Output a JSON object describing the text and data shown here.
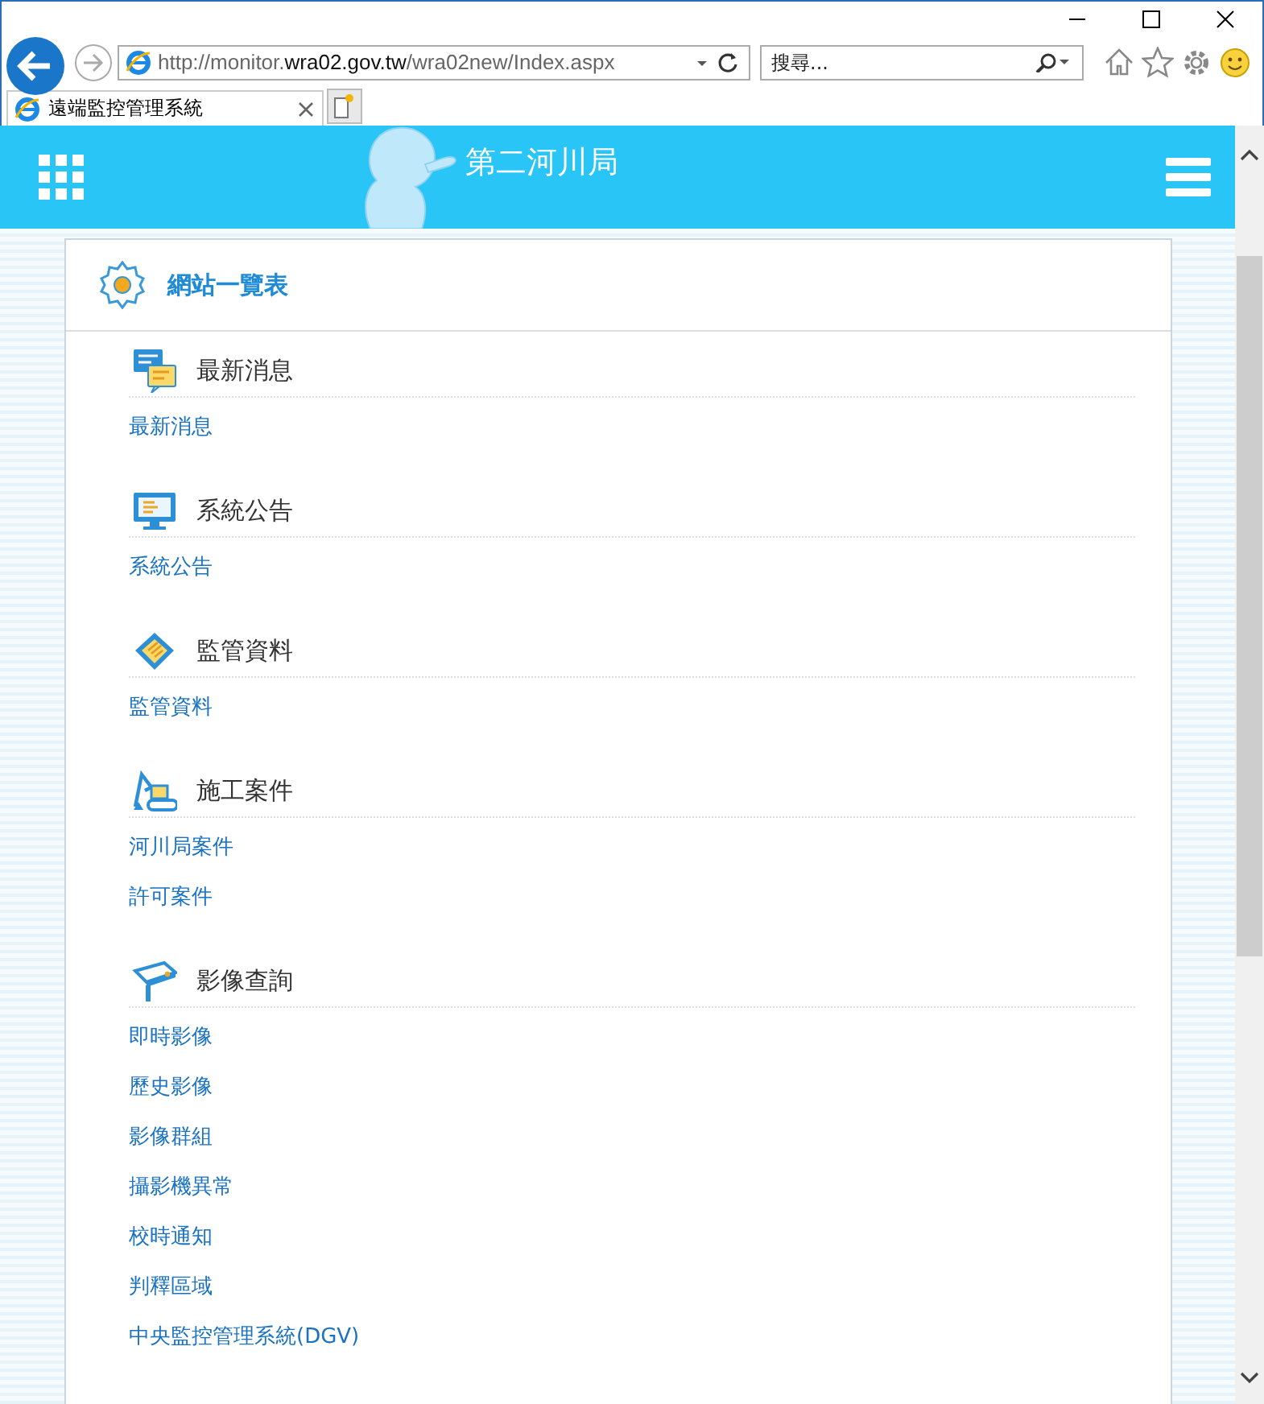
{
  "browser": {
    "address": "http://monitor.**wra02.gov.tw**/wra02new/Index.aspx",
    "search_placeholder": "搜尋...",
    "tabs": [
      {
        "title": "遠端監控管理系統",
        "selected": true
      }
    ]
  },
  "header": {
    "title": "第二河川局"
  },
  "card": {
    "title": "網站一覽表",
    "sections": [
      {
        "kind": "chat",
        "title": "最新消息",
        "links": [
          "最新消息"
        ]
      },
      {
        "kind": "monitor",
        "title": "系統公告",
        "links": [
          "系統公告"
        ]
      },
      {
        "kind": "card",
        "title": "監管資料",
        "links": [
          "監管資料"
        ]
      },
      {
        "kind": "excavator",
        "title": "施工案件",
        "links": [
          "河川局案件",
          "許可案件"
        ]
      },
      {
        "kind": "camera",
        "title": "影像查詢",
        "links": [
          "即時影像",
          "歷史影像",
          "影像群組",
          "攝影機異常",
          "校時通知",
          "判釋區域",
          "中央監控管理系統(DGV)"
        ]
      }
    ]
  }
}
